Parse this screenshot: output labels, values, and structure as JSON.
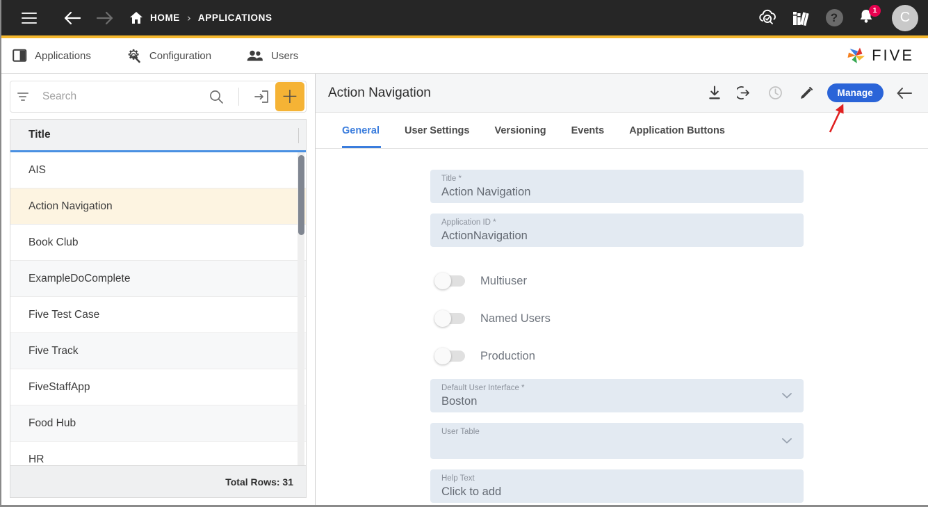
{
  "topbar": {
    "menu_icon": "hamburger-menu-icon",
    "back_icon": "arrow-left-icon",
    "forward_icon": "arrow-right-icon",
    "home_icon": "home-icon",
    "breadcrumbs": [
      {
        "label": "HOME"
      },
      {
        "label": "APPLICATIONS"
      }
    ],
    "separator": "›",
    "actions": [
      {
        "name": "cloud-check-icon"
      },
      {
        "name": "library-books-icon"
      },
      {
        "name": "help-icon",
        "glyph": "?"
      },
      {
        "name": "notifications-bell-icon",
        "badge": "1"
      }
    ],
    "avatar_initial": "C"
  },
  "navbar": {
    "items": [
      {
        "label": "Applications",
        "icon": "panel-icon"
      },
      {
        "label": "Configuration",
        "icon": "gear-wrench-icon"
      },
      {
        "label": "Users",
        "icon": "people-icon"
      }
    ],
    "logo_text": "FIVE"
  },
  "sidebar": {
    "search": {
      "placeholder": "Search",
      "value": ""
    },
    "filter_icon": "filter-icon",
    "search_icon": "search-icon",
    "import_icon": "import-icon",
    "add_label": "+",
    "column_header": "Title",
    "rows": [
      {
        "title": "AIS"
      },
      {
        "title": "Action Navigation"
      },
      {
        "title": "Book Club"
      },
      {
        "title": "ExampleDoComplete"
      },
      {
        "title": "Five Test Case"
      },
      {
        "title": "Five Track"
      },
      {
        "title": "FiveStaffApp"
      },
      {
        "title": "Food Hub"
      },
      {
        "title": "HR"
      }
    ],
    "selected_row_index": 1,
    "footer": "Total Rows: 31"
  },
  "detail": {
    "title": "Action Navigation",
    "tools": [
      {
        "name": "download-icon"
      },
      {
        "name": "deploy-arrow-icon"
      },
      {
        "name": "history-clock-icon",
        "disabled": true
      },
      {
        "name": "edit-pencil-icon"
      }
    ],
    "manage_label": "Manage",
    "back_icon": "arrow-left-icon",
    "tabs": [
      {
        "label": "General",
        "active": true
      },
      {
        "label": "User Settings",
        "active": false
      },
      {
        "label": "Versioning",
        "active": false
      },
      {
        "label": "Events",
        "active": false
      },
      {
        "label": "Application Buttons",
        "active": false
      }
    ],
    "fields": {
      "title": {
        "label": "Title *",
        "value": "Action Navigation"
      },
      "application_id": {
        "label": "Application ID *",
        "value": "ActionNavigation"
      },
      "default_user_interface": {
        "label": "Default User Interface *",
        "value": "Boston"
      },
      "user_table": {
        "label": "User Table",
        "value": ""
      },
      "help_text": {
        "label": "Help Text",
        "value": "Click to add"
      }
    },
    "toggles": [
      {
        "label": "Multiuser",
        "on": false
      },
      {
        "label": "Named Users",
        "on": false
      },
      {
        "label": "Production",
        "on": false
      }
    ]
  },
  "colors": {
    "accent_yellow": "#F5B82E",
    "primary_blue": "#2a64d8",
    "tab_blue": "#3b7ddd",
    "selected_row": "#fdf4e1",
    "badge_pink": "#e8004f",
    "annotation_red": "#e02020"
  }
}
